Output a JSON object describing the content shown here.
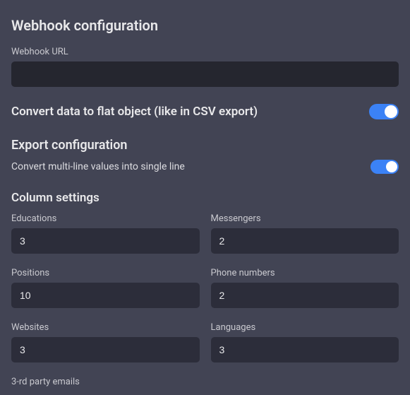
{
  "webhook": {
    "section_title": "Webhook configuration",
    "url_label": "Webhook URL",
    "url_value": ""
  },
  "flat_object": {
    "label": "Convert data to flat object (like in CSV export)",
    "enabled": true
  },
  "export_config": {
    "title": "Export configuration",
    "multiline_label": "Convert multi-line values into single line",
    "multiline_enabled": true
  },
  "column_settings": {
    "title": "Column settings",
    "fields": {
      "educations": {
        "label": "Educations",
        "value": "3"
      },
      "messengers": {
        "label": "Messengers",
        "value": "2"
      },
      "positions": {
        "label": "Positions",
        "value": "10"
      },
      "phone_numbers": {
        "label": "Phone numbers",
        "value": "2"
      },
      "websites": {
        "label": "Websites",
        "value": "3"
      },
      "languages": {
        "label": "Languages",
        "value": "3"
      },
      "third_party_emails": {
        "label": "3-rd party emails"
      }
    }
  }
}
